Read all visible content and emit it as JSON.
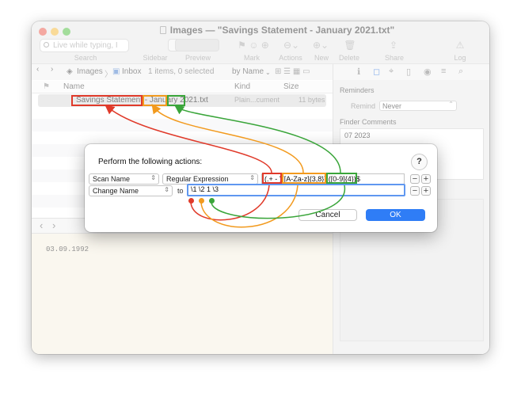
{
  "window": {
    "title": "Images — \"Savings Statement - January 2021.txt\""
  },
  "toolbar": {
    "search_placeholder": "Live while typing, I",
    "labels": {
      "search": "Search",
      "sidebar": "Sidebar",
      "preview": "Preview",
      "mark": "Mark",
      "actions": "Actions",
      "new": "New",
      "delete": "Delete",
      "share": "Share",
      "log": "Log"
    }
  },
  "pathbar": {
    "database": "Images",
    "group": "Inbox",
    "status": "1 items, 0 selected",
    "sort": "by Name"
  },
  "list": {
    "columns": {
      "name": "Name",
      "kind": "Kind",
      "size": "Size"
    },
    "rows": [
      {
        "name": "Savings Statement - January 2021.txt",
        "kind": "Plain...cument",
        "size": "11 bytes"
      }
    ]
  },
  "preview": {
    "content": "03.09.1992"
  },
  "inspector": {
    "reminders_label": "Reminders",
    "remind_label": "Remind",
    "remind_value": "Never",
    "comments_label": "Finder Comments",
    "comments_text": "07 2023"
  },
  "dialog": {
    "title": "Perform the following actions:",
    "help_label": "?",
    "row1": {
      "action": "Scan Name",
      "mode": "Regular Expression",
      "pattern": "(.+ - )([A-Za-z]{3,8}) ([0-9]{4})$",
      "pattern_parts": [
        "(.+ - )",
        "([A-Za-z]{3,8}) ",
        "([0-9]{4})",
        "$"
      ]
    },
    "row2": {
      "action": "Change Name",
      "to_label": "to",
      "value": "\\1 \\2 1 \\3"
    },
    "minus_label": "−",
    "plus_label": "+",
    "cancel_label": "Cancel",
    "ok_label": "OK"
  },
  "annotation_colors": {
    "red": "#e03a2a",
    "orange": "#f29a1e",
    "green": "#3aa53a"
  }
}
